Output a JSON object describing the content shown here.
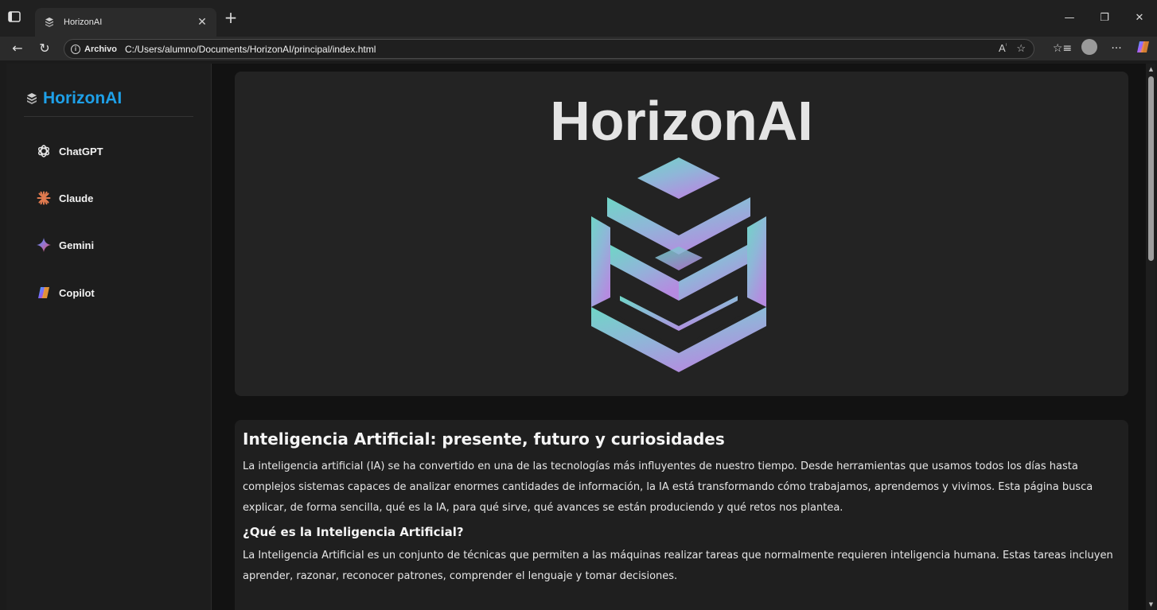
{
  "browser": {
    "tab_title": "HorizonAI",
    "tab_close": "✕",
    "new_tab": "+",
    "address_label": "Archivo",
    "address_url": "C:/Users/alumno/Documents/HorizonAI/principal/index.html",
    "controls": {
      "minimize": "—",
      "restore": "❐",
      "close": "✕"
    }
  },
  "sidebar": {
    "brand": "HorizonAI",
    "items": [
      {
        "label": "ChatGPT",
        "icon": "chatgpt-icon"
      },
      {
        "label": "Claude",
        "icon": "claude-icon"
      },
      {
        "label": "Gemini",
        "icon": "gemini-icon"
      },
      {
        "label": "Copilot",
        "icon": "copilot-icon"
      }
    ]
  },
  "hero": {
    "title": "HorizonAI"
  },
  "article": {
    "heading": "Inteligencia Artificial: presente, futuro y curiosidades",
    "intro": "La inteligencia artificial (IA) se ha convertido en una de las tecnologías más influyentes de nuestro tiempo. Desde herramientas que usamos todos los días hasta complejos sistemas capaces de analizar enormes cantidades de información, la IA está transformando cómo trabajamos, aprendemos y vivimos. Esta página busca explicar, de forma sencilla, qué es la IA, para qué sirve, qué avances se están produciendo y qué retos nos plantea.",
    "subheading": "¿Qué es la Inteligencia Artificial?",
    "definition": "La Inteligencia Artificial es un conjunto de técnicas que permiten a las máquinas realizar tareas que normalmente requieren inteligencia humana. Estas tareas incluyen aprender, razonar, reconocer patrones, comprender el lenguaje y tomar decisiones."
  },
  "colors": {
    "brand": "#1ea0e8",
    "background": "#121212",
    "card": "#232323",
    "logo_gradient_start": "#6fd6c6",
    "logo_gradient_end": "#b58be0"
  }
}
